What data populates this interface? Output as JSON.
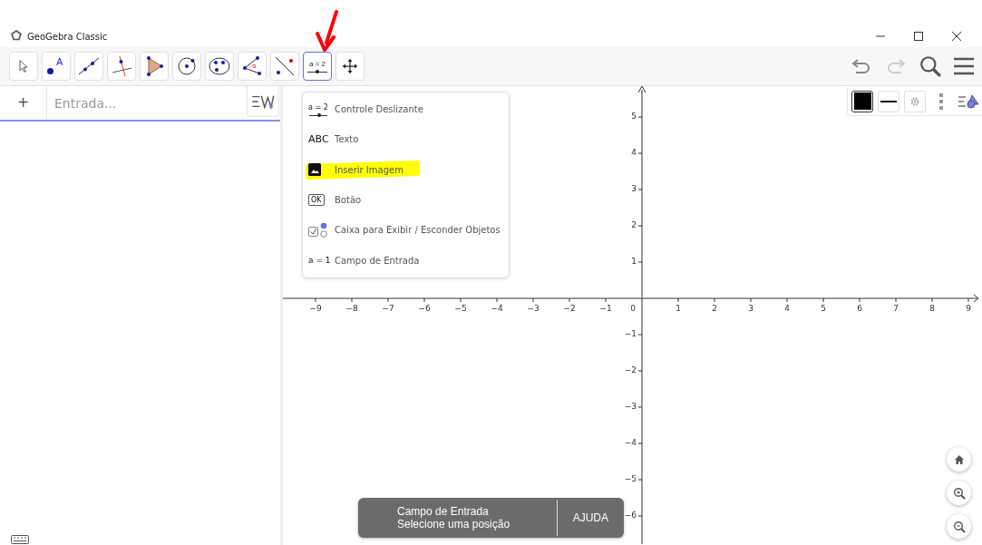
{
  "window": {
    "title": "GeoGebra Classic"
  },
  "tools": [
    {
      "kind": "pointer",
      "selected": false
    },
    {
      "kind": "point",
      "selected": false,
      "icon_text": "A"
    },
    {
      "kind": "line",
      "selected": false
    },
    {
      "kind": "perpendicular",
      "selected": false
    },
    {
      "kind": "polygon",
      "selected": false
    },
    {
      "kind": "circle",
      "selected": false
    },
    {
      "kind": "conic",
      "selected": false
    },
    {
      "kind": "angle",
      "selected": false,
      "icon_text": "α"
    },
    {
      "kind": "reflect",
      "selected": false
    },
    {
      "kind": "slider",
      "selected": true,
      "icon_text": "a = 2"
    },
    {
      "kind": "move_view",
      "selected": false
    }
  ],
  "algebra": {
    "add_label": "+",
    "input": {
      "placeholder": "Entrada..."
    }
  },
  "tool_menu": {
    "items": [
      {
        "kind": "slider",
        "icon_text": "a = 2",
        "label": "Controle Deslizante",
        "highlighted": false
      },
      {
        "kind": "text",
        "icon_text": "ABC",
        "label": "Texto",
        "highlighted": false
      },
      {
        "kind": "image",
        "label": "Inserir Imagem",
        "highlighted": true
      },
      {
        "kind": "button",
        "icon_text": "OK",
        "label": "Botão",
        "highlighted": false
      },
      {
        "kind": "checkbox",
        "label": "Caixa para Exibir / Esconder Objetos",
        "highlighted": false
      },
      {
        "kind": "inputbox",
        "icon_text": "a = 1",
        "label": "Campo de Entrada",
        "highlighted": false
      }
    ]
  },
  "graphics": {
    "x_left_labels": [
      "−9",
      "−8",
      "−7",
      "−6",
      "−5",
      "−4",
      "−3",
      "−2",
      "−1"
    ],
    "origin_label": "0",
    "x_right_labels": [
      "1",
      "2",
      "3",
      "4",
      "5",
      "6",
      "7",
      "8",
      "9"
    ],
    "y_up_labels": [
      "5",
      "4",
      "3",
      "2",
      "1"
    ],
    "y_down_labels": [
      "−1",
      "−2",
      "−3",
      "−4",
      "−5",
      "−6"
    ]
  },
  "snackbar": {
    "title": "Campo de Entrada",
    "message": "Selecione uma posição",
    "action": "AJUDA"
  }
}
